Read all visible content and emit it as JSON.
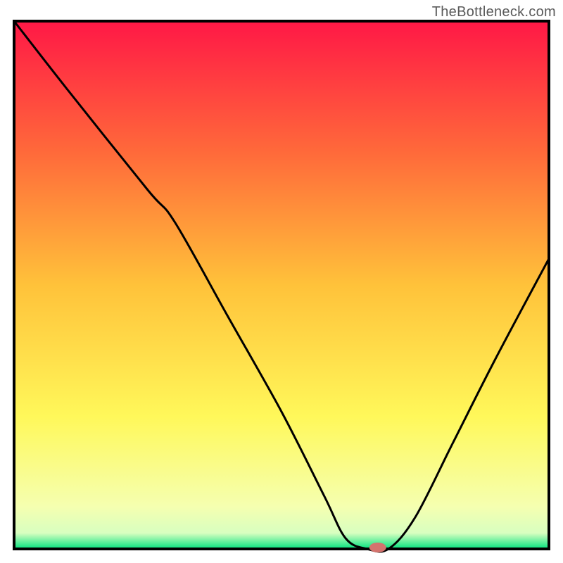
{
  "watermark": {
    "text": "TheBottleneck.com"
  },
  "chart_data": {
    "type": "line",
    "title": "",
    "xlabel": "",
    "ylabel": "",
    "xlim": [
      0,
      100
    ],
    "ylim": [
      0,
      100
    ],
    "grid": false,
    "legend": false,
    "background_gradient": {
      "stops": [
        {
          "offset": 0.0,
          "color": "#ff1846"
        },
        {
          "offset": 0.25,
          "color": "#ff6a3a"
        },
        {
          "offset": 0.5,
          "color": "#ffc23a"
        },
        {
          "offset": 0.75,
          "color": "#fff85a"
        },
        {
          "offset": 0.92,
          "color": "#f5ffb0"
        },
        {
          "offset": 0.97,
          "color": "#d8ffc0"
        },
        {
          "offset": 1.0,
          "color": "#02e27e"
        }
      ]
    },
    "series": [
      {
        "name": "bottleneck-curve",
        "color": "#000000",
        "x": [
          0,
          10,
          25,
          30,
          40,
          50,
          58,
          62,
          66,
          70,
          75,
          82,
          90,
          100
        ],
        "y": [
          100,
          87,
          68,
          62,
          44,
          26,
          10,
          2,
          0,
          0,
          6,
          20,
          36,
          55
        ]
      }
    ],
    "marker": {
      "name": "optimal-point",
      "x": 68,
      "y": 0,
      "color": "#d4736e",
      "rx": 12,
      "ry": 7
    },
    "axes": {
      "frame_color": "#000000",
      "frame_width": 4
    }
  }
}
